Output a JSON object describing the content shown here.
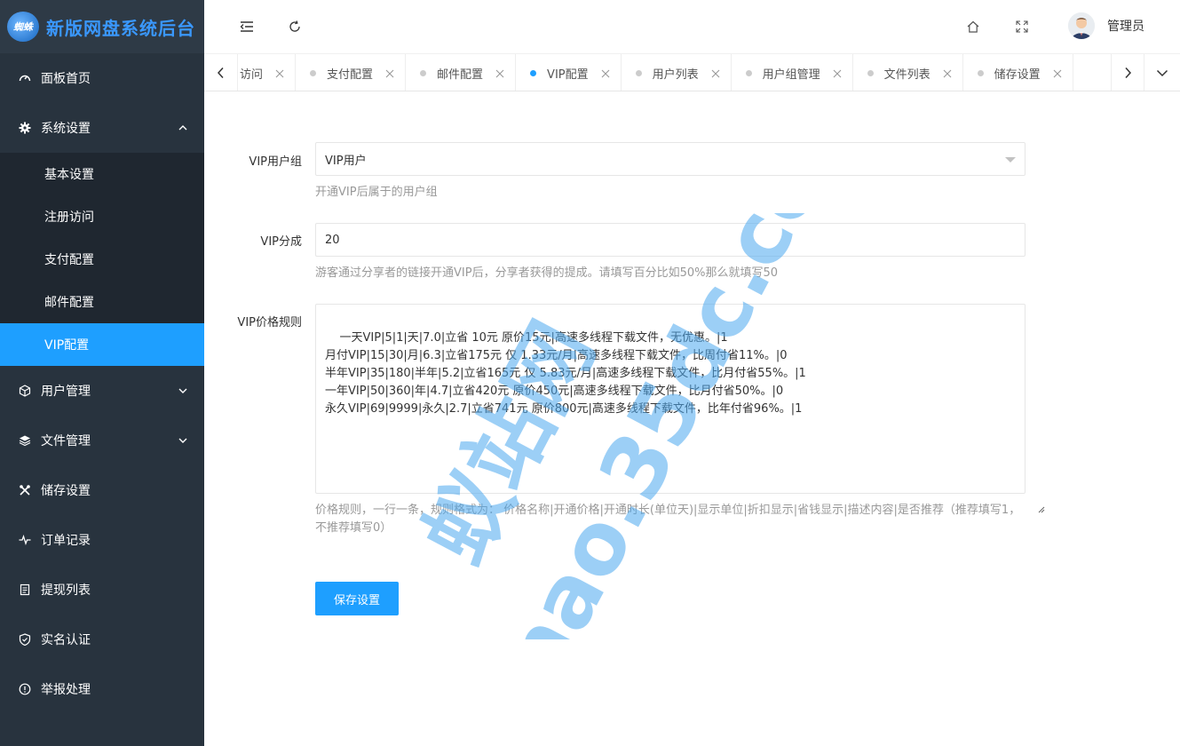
{
  "app": {
    "title": "新版网盘系统后台",
    "logo_mark": "蜘蛛"
  },
  "sidebar": {
    "home": "面板首页",
    "settings": "系统设置",
    "sub": [
      "基本设置",
      "注册访问",
      "支付配置",
      "邮件配置",
      "VIP配置"
    ],
    "items": [
      "用户管理",
      "文件管理",
      "储存设置",
      "订单记录",
      "提现列表",
      "实名认证",
      "举报处理"
    ]
  },
  "header": {
    "user": "管理员"
  },
  "tabs": [
    "访问",
    "支付配置",
    "邮件配置",
    "VIP配置",
    "用户列表",
    "用户组管理",
    "文件列表",
    "储存设置"
  ],
  "active_tab": 3,
  "form": {
    "group_label": "VIP用户组",
    "group_value": "VIP用户",
    "group_hint": "开通VIP后属于的用户组",
    "share_label": "VIP分成",
    "share_value": "20",
    "share_hint": "游客通过分享者的链接开通VIP后，分享者获得的提成。请填写百分比如50%那么就填写50",
    "rules_label": "VIP价格规则",
    "rules_value": "一天VIP|5|1|天|7.0|立省 10元 原价15元|高速多线程下载文件，无优惠。|1\n月付VIP|15|30|月|6.3|立省175元 仅 1.33元/月|高速多线程下载文件，比周付省11%。|0\n半年VIP|35|180|半年|5.2|立省165元 仅 5.83元/月|高速多线程下载文件，比月付省55%。|1\n一年VIP|50|360|年|4.7|立省420元 原价450元|高速多线程下载文件，比月付省50%。|0\n永久VIP|69|9999|永久|2.7|立省741元 原价800元|高速多线程下载文件，比年付省96%。|1",
    "rules_hint": "价格规则，一行一条，规则格式为： 价格名称|开通价格|开通时长(单位天)|显示单位|折扣显示|省钱显示|描述内容|是否推荐（推荐填写1，不推荐填写0）",
    "save": "保存设置"
  },
  "watermark": {
    "line1": "蚁站网",
    "line2": "hao.35dc.com"
  },
  "colors": {
    "sidebar": "#28333e",
    "submenu": "#1f2730",
    "accent": "#1e9fff"
  }
}
